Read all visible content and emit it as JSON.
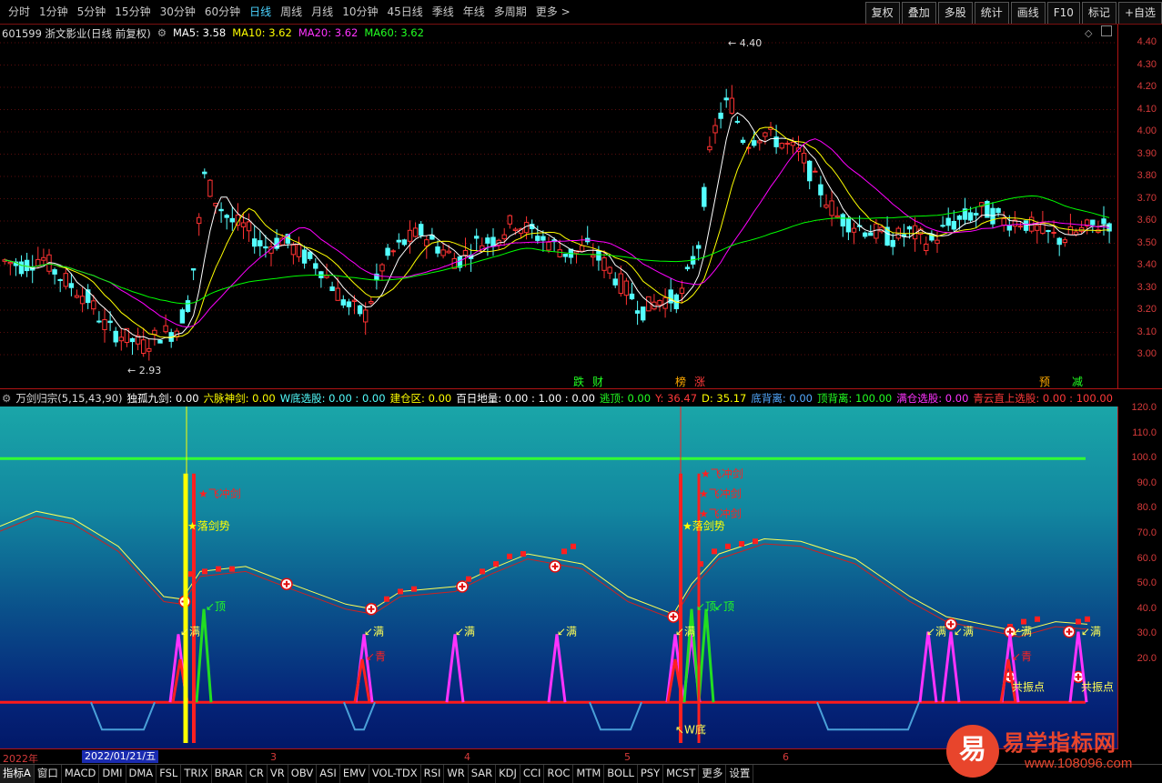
{
  "toolbar": {
    "periods": [
      "分时",
      "1分钟",
      "5分钟",
      "15分钟",
      "30分钟",
      "60分钟",
      "日线",
      "周线",
      "月线",
      "10分钟",
      "45日线",
      "季线",
      "年线",
      "多周期",
      "更多 >"
    ],
    "active_period": "日线",
    "buttons": [
      "复权",
      "叠加",
      "多股",
      "统计",
      "画线",
      "F10",
      "标记",
      "+自选"
    ]
  },
  "main": {
    "stock_title": "601599 浙文影业(日线 前复权)",
    "ma5": "MA5: 3.58",
    "ma10": "MA10: 3.62",
    "ma20": "MA20: 3.62",
    "ma60": "MA60: 3.62",
    "price_ticks": [
      "4.40",
      "4.30",
      "4.20",
      "4.10",
      "4.00",
      "3.90",
      "3.80",
      "3.70",
      "3.60",
      "3.50",
      "3.40",
      "3.30",
      "3.20",
      "3.10",
      "3.00"
    ],
    "high_label": "4.40",
    "low_label": "2.93",
    "signal_labels": [
      "跌",
      "财",
      "榜",
      "涨",
      "预",
      "减"
    ],
    "colors": {
      "up": "#ff3232",
      "down": "#54ffff",
      "ma5": "#ffffff",
      "ma10": "#ffff00",
      "ma20": "#ff00ff",
      "ma60": "#00ff00"
    }
  },
  "indicator": {
    "name": "万剑归宗(5,15,43,90)",
    "fields": [
      {
        "label": "独孤九剑: 0.00",
        "color": "#ffffff"
      },
      {
        "label": "六脉神剑: 0.00",
        "color": "#ffff00"
      },
      {
        "label": "W底选股: 0.00 : 0.00",
        "color": "#54ffff"
      },
      {
        "label": "建仓区: 0.00",
        "color": "#ffff00"
      },
      {
        "label": "百日地量: 0.00 : 1.00 : 0.00",
        "color": "#ffffff"
      },
      {
        "label": "逃顶: 0.00",
        "color": "#22ff22"
      },
      {
        "label": "Y: 36.47",
        "color": "#ff3a3a"
      },
      {
        "label": "D: 35.17",
        "color": "#ffff00"
      },
      {
        "label": "底背离: 0.00",
        "color": "#54aaff"
      },
      {
        "label": "顶背离: 100.00",
        "color": "#22ff22"
      },
      {
        "label": "满仓选股: 0.00",
        "color": "#ff33ff"
      },
      {
        "label": "青云直上选股: 0.00 : 100.00",
        "color": "#ff3a3a"
      }
    ],
    "yticks": [
      "120.0",
      "110.0",
      "100.0",
      "90.0",
      "80.0",
      "70.0",
      "60.0",
      "50.0",
      "40.0",
      "30.0",
      "20.0"
    ],
    "annotations": {
      "fly_sword": "飞冲剑",
      "fall_sword": "落剑势",
      "top": "顶",
      "full": "满",
      "green": "青",
      "resonance": "共振点",
      "w_bottom": "W底"
    }
  },
  "date_axis": {
    "year": "2022年",
    "cursor_date": "2022/01/21/五",
    "months": [
      "3",
      "4",
      "5",
      "6"
    ]
  },
  "bottom_tabs": [
    "指标A",
    "窗口",
    "MACD",
    "DMI",
    "DMA",
    "FSL",
    "TRIX",
    "BRAR",
    "CR",
    "VR",
    "OBV",
    "ASI",
    "EMV",
    "VOL-TDX",
    "RSI",
    "WR",
    "SAR",
    "KDJ",
    "CCI",
    "ROC",
    "MTM",
    "BOLL",
    "PSY",
    "MCST",
    "更多",
    "设置"
  ],
  "watermark": {
    "glyph": "易",
    "title": "易学指标网",
    "url": "www.108096.com"
  }
}
